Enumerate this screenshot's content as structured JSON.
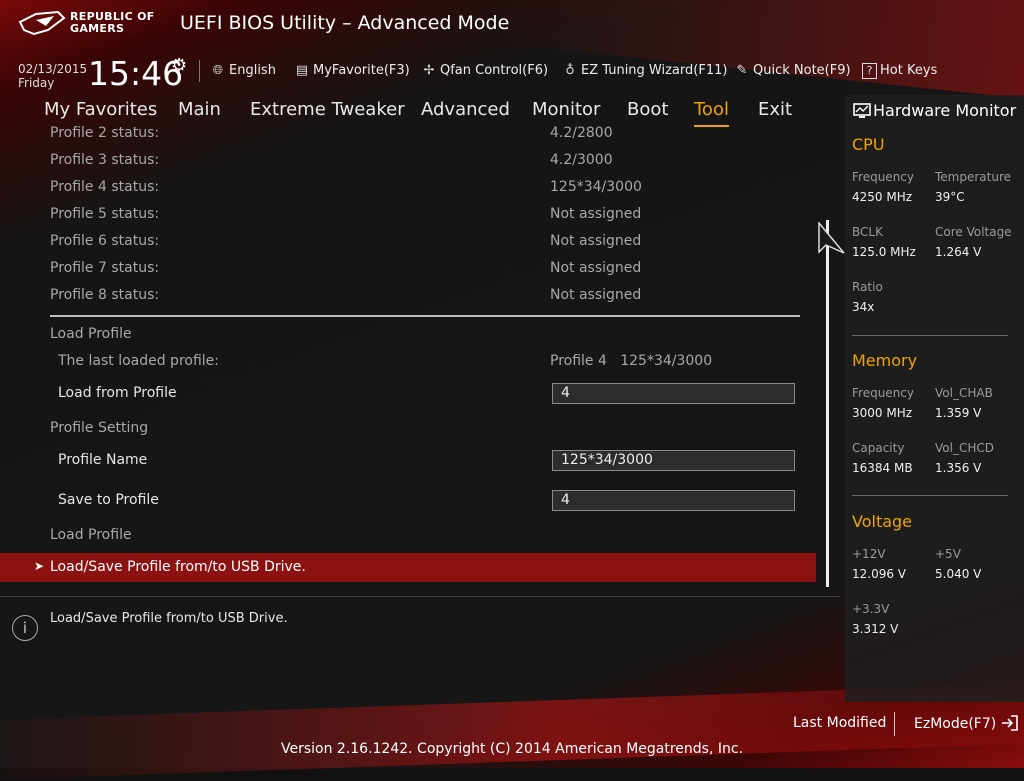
{
  "header": {
    "brand_line1": "REPUBLIC OF",
    "brand_line2": "GAMERS",
    "title": "UEFI BIOS Utility – Advanced Mode",
    "date": "02/13/2015",
    "day": "Friday",
    "time": "15:46",
    "toolbar": {
      "language": "English",
      "favorite": "MyFavorite(F3)",
      "qfan": "Qfan Control(F6)",
      "ez_tuning": "EZ Tuning Wizard(F11)",
      "quick_note": "Quick Note(F9)",
      "hot_keys": "Hot Keys"
    }
  },
  "nav": {
    "tabs": [
      "My Favorites",
      "Main",
      "Extreme Tweaker",
      "Advanced",
      "Monitor",
      "Boot",
      "Tool",
      "Exit"
    ],
    "active": "Tool"
  },
  "content": {
    "profiles": [
      {
        "label": "Profile 2 status:",
        "value": "4.2/2800"
      },
      {
        "label": "Profile 3 status:",
        "value": "4.2/3000"
      },
      {
        "label": "Profile 4 status:",
        "value": "125*34/3000"
      },
      {
        "label": "Profile 5 status:",
        "value": "Not assigned"
      },
      {
        "label": "Profile 6 status:",
        "value": "Not assigned"
      },
      {
        "label": "Profile 7 status:",
        "value": "Not assigned"
      },
      {
        "label": "Profile 8 status:",
        "value": "Not assigned"
      }
    ],
    "load_profile_heading": "Load Profile",
    "last_loaded_label": "The last loaded profile:",
    "last_loaded_value": "Profile 4   125*34/3000",
    "load_from_label": "Load from Profile",
    "load_from_value": "4",
    "profile_setting_heading": "Profile Setting",
    "profile_name_label": "Profile Name",
    "profile_name_value": "125*34/3000",
    "save_to_label": "Save to Profile",
    "save_to_value": "4",
    "load_profile_heading2": "Load Profile",
    "usb_item": "Load/Save Profile from/to USB Drive."
  },
  "help": {
    "text": "Load/Save Profile from/to USB Drive."
  },
  "hardware_monitor": {
    "title": "Hardware Monitor",
    "cpu": {
      "heading": "CPU",
      "frequency_label": "Frequency",
      "frequency": "4250 MHz",
      "temperature_label": "Temperature",
      "temperature": "39°C",
      "bclk_label": "BCLK",
      "bclk": "125.0 MHz",
      "core_voltage_label": "Core Voltage",
      "core_voltage": "1.264 V",
      "ratio_label": "Ratio",
      "ratio": "34x"
    },
    "memory": {
      "heading": "Memory",
      "frequency_label": "Frequency",
      "frequency": "3000 MHz",
      "vol_chab_label": "Vol_CHAB",
      "vol_chab": "1.359 V",
      "capacity_label": "Capacity",
      "capacity": "16384 MB",
      "vol_chcd_label": "Vol_CHCD",
      "vol_chcd": "1.356 V"
    },
    "voltage": {
      "heading": "Voltage",
      "v12_label": "+12V",
      "v12": "12.096 V",
      "v5_label": "+5V",
      "v5": "5.040 V",
      "v33_label": "+3.3V",
      "v33": "3.312 V"
    }
  },
  "footer": {
    "last_modified": "Last Modified",
    "ez_mode": "EzMode(F7)",
    "version": "Version 2.16.1242. Copyright (C) 2014 American Megatrends, Inc."
  },
  "colors": {
    "accent": "#f0a400",
    "highlight": "#8c1212"
  }
}
